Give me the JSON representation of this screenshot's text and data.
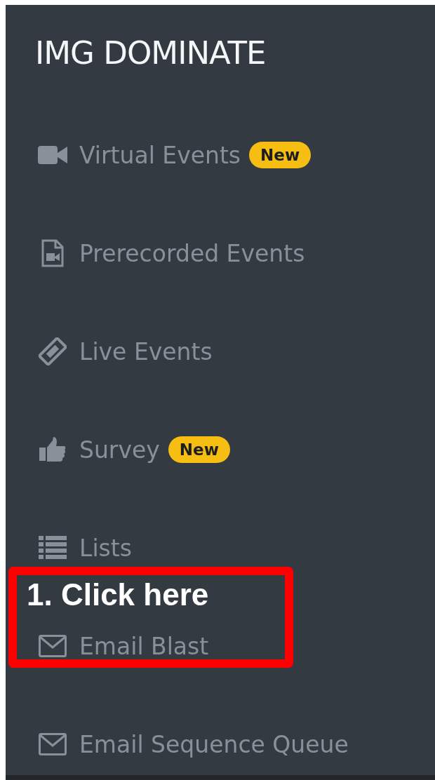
{
  "sidebar": {
    "title": "IMG DOMINATE",
    "items": [
      {
        "kind": "video",
        "label": "Virtual Events",
        "badge": "New"
      },
      {
        "kind": "file-video",
        "label": "Prerecorded Events"
      },
      {
        "kind": "ticket",
        "label": "Live Events"
      },
      {
        "kind": "thumbs-up",
        "label": "Survey",
        "badge": "New"
      },
      {
        "kind": "list",
        "label": "Lists"
      },
      {
        "kind": "envelope",
        "label": "Email Blast"
      },
      {
        "kind": "envelope",
        "label": "Email Sequence Queue"
      }
    ]
  },
  "annotation": {
    "text": "1. Click here"
  }
}
